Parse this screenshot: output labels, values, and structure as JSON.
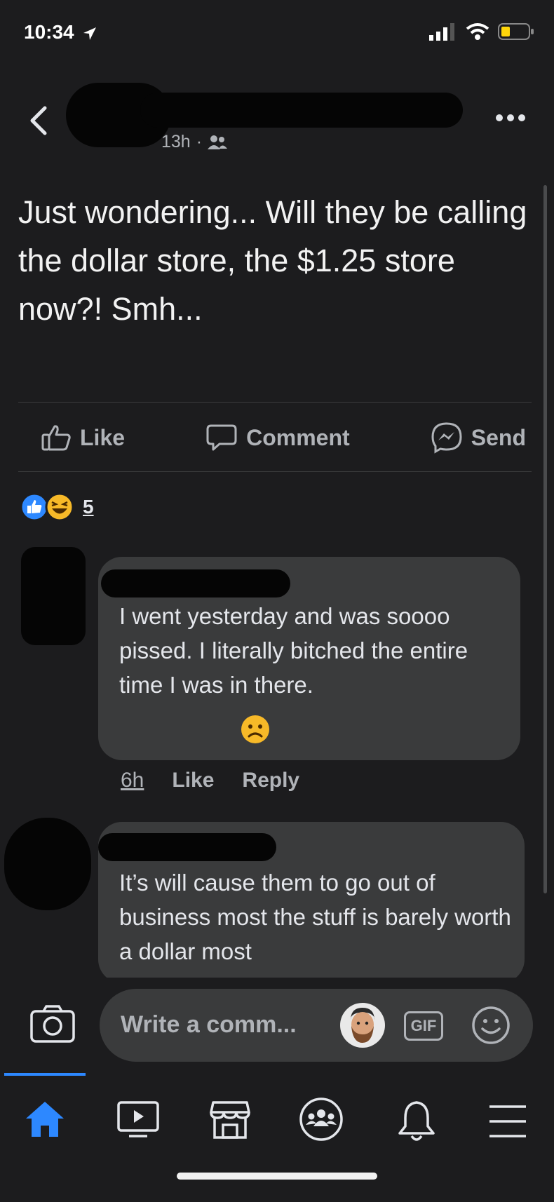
{
  "status_bar": {
    "time": "10:34"
  },
  "post": {
    "timestamp": "13h",
    "separator": "·",
    "text": "Just wondering... Will they be calling the dollar store, the $1.25 store now?! Smh..."
  },
  "actions": {
    "like": "Like",
    "comment": "Comment",
    "send": "Send"
  },
  "reactions": {
    "count": "5"
  },
  "comments": [
    {
      "text": "I went yesterday and was soooo pissed. I literally bitched the entire time I was in there.",
      "time": "6h",
      "like": "Like",
      "reply": "Reply"
    },
    {
      "text": "It’s will cause them to go out of business most the stuff is barely worth a dollar most"
    }
  ],
  "composer": {
    "placeholder": "Write a comm...",
    "gif_label": "GIF"
  },
  "colors": {
    "background": "#1c1c1e",
    "bubble": "#3a3b3c",
    "accent": "#2d88ff",
    "muted": "#b0b3b8"
  },
  "icons": {
    "header": [
      "back-icon",
      "more-icon",
      "friends-icon"
    ],
    "tabs": [
      "home-icon",
      "watch-icon",
      "marketplace-icon",
      "groups-icon",
      "notifications-icon",
      "menu-icon"
    ]
  }
}
